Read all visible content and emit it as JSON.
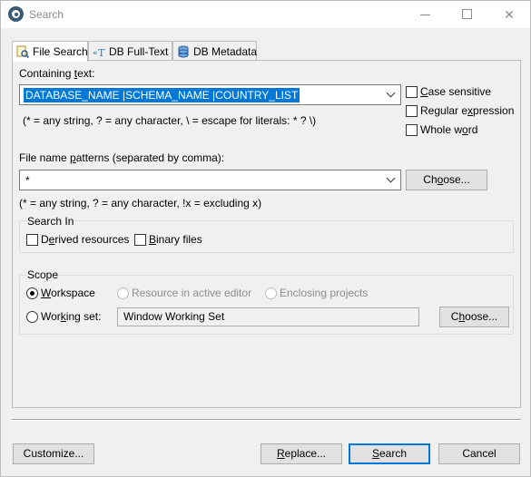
{
  "window": {
    "title": "Search"
  },
  "tabs": [
    {
      "label": "File Search",
      "icon": "file-search-icon",
      "active": true
    },
    {
      "label": "DB Full-Text",
      "icon": "db-fulltext-icon",
      "active": false
    },
    {
      "label": "DB Metadata",
      "icon": "db-metadata-icon",
      "active": false
    }
  ],
  "containing": {
    "label_pre": "Containing ",
    "label_accel": "t",
    "label_post": "ext:",
    "value": "DATABASE_NAME |SCHEMA_NAME  |COUNTRY_LIST",
    "hint": "(* = any string, ? = any character, \\ = escape for literals: * ? \\)"
  },
  "options": {
    "case_sensitive": {
      "accel": "C",
      "rest": "ase sensitive"
    },
    "regex": {
      "pre": "Regular e",
      "accel": "x",
      "post": "pression"
    },
    "whole_word": {
      "pre": "Whole w",
      "accel": "o",
      "post": "rd"
    }
  },
  "file_patterns": {
    "label_pre": "File name ",
    "label_accel": "p",
    "label_post": "atterns (separated by comma):",
    "value": "*",
    "hint": "(* = any string, ? = any character, !x = excluding x)",
    "choose_pre": "Ch",
    "choose_accel": "o",
    "choose_post": "ose..."
  },
  "search_in": {
    "title": "Search In",
    "derived": {
      "pre": "D",
      "accel": "e",
      "post": "rived resources"
    },
    "binary": {
      "accel": "B",
      "post": "inary files"
    }
  },
  "scope": {
    "title": "Scope",
    "workspace": {
      "accel": "W",
      "post": "orkspace"
    },
    "resource_active": "Resource in active editor",
    "enclosing": "Enclosing projects",
    "working_set": {
      "pre": "Wor",
      "accel": "k",
      "post": "ing set:"
    },
    "working_set_value": "Window Working Set",
    "choose_pre": "C",
    "choose_accel": "h",
    "choose_post": "oose..."
  },
  "buttons": {
    "customize": "Customize...",
    "replace_accel": "R",
    "replace_post": "eplace...",
    "search_accel": "S",
    "search_post": "earch",
    "cancel": "Cancel"
  },
  "colors": {
    "selection": "#0078d7",
    "default_button_border": "#0078d7"
  }
}
